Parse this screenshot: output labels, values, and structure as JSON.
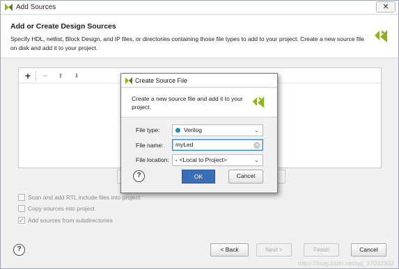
{
  "window": {
    "title": "Add Sources",
    "close_glyph": "✕"
  },
  "header": {
    "title": "Add or Create Design Sources",
    "description": "Specify HDL, netlist, Block Design, and IP files, or directories containing those file types to add to your project. Create a new source file on disk and add it to your project."
  },
  "toolbar": {
    "add": "+",
    "remove": "−",
    "up": "⬆",
    "down": "⬇"
  },
  "options": [
    {
      "label": "Scan and add RTL include files into project",
      "checked": false
    },
    {
      "label": "Copy sources into project",
      "checked": false
    },
    {
      "label": "Add sources from subdirectories",
      "checked": true
    }
  ],
  "footer": {
    "help": "?",
    "back": "< Back",
    "next": "Next >",
    "finish": "Finish",
    "cancel": "Cancel"
  },
  "dialog": {
    "title": "Create Source File",
    "description": "Create a new source file and add it to your project.",
    "file_type_label": "File type:",
    "file_type_value": "Verilog",
    "file_name_label": "File name:",
    "file_name_value": "myLed",
    "file_location_label": "File location:",
    "file_location_value": "<Local to Project>",
    "help": "?",
    "ok": "OK",
    "cancel": "Cancel"
  },
  "watermark": "https://blog.csdn.net/qq_37032932",
  "colors": {
    "accent": "#3a6fb8",
    "logo": "#8bb420",
    "verilog_dot": "#2e8ba6"
  }
}
